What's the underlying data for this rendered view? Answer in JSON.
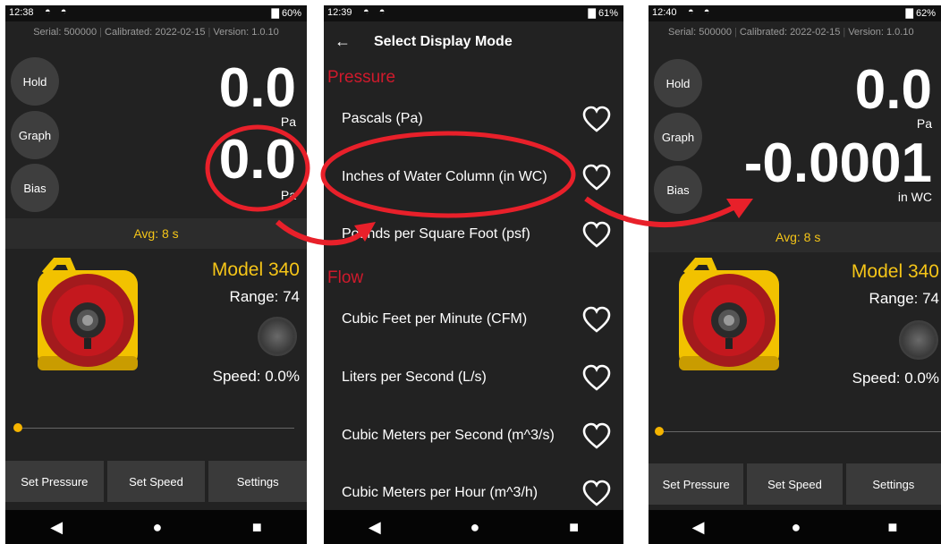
{
  "screen1": {
    "status": {
      "time": "12:38",
      "icons": "◓ ◓",
      "battery": "▇ 60%"
    },
    "info": {
      "serial": "Serial: 500000",
      "calibrated": "Calibrated: 2022-02-15",
      "version": "Version: 1.0.10"
    },
    "buttons": {
      "hold": "Hold",
      "graph": "Graph",
      "bias": "Bias"
    },
    "reading1": {
      "value": "0.0",
      "unit": "Pa"
    },
    "reading2": {
      "value": "0.0",
      "unit": "Pa"
    },
    "avg": "Avg: 8 s",
    "model": "Model 340",
    "range": "Range: 74",
    "speed": "Speed: 0.0%",
    "slider_level": 0.0,
    "bottom": {
      "set_pressure": "Set Pressure",
      "set_speed": "Set Speed",
      "settings": "Settings"
    }
  },
  "screen2": {
    "status": {
      "time": "12:39",
      "icons": "◓ ◓",
      "battery": "▇ 61%"
    },
    "back": "←",
    "title": "Select Display Mode",
    "section_pressure": "Pressure",
    "pressure_items": [
      "Pascals (Pa)",
      "Inches of Water Column (in WC)",
      "Pounds per Square Foot (psf)"
    ],
    "section_flow": "Flow",
    "flow_items": [
      "Cubic Feet per Minute (CFM)",
      "Liters per Second (L/s)",
      "Cubic Meters per Second (m^3/s)",
      "Cubic Meters per Hour (m^3/h)"
    ]
  },
  "screen3": {
    "status": {
      "time": "12:40",
      "icons": "◓ ◓",
      "battery": "▇ 62%"
    },
    "info": {
      "serial": "Serial: 500000",
      "calibrated": "Calibrated: 2022-02-15",
      "version": "Version: 1.0.10"
    },
    "buttons": {
      "hold": "Hold",
      "graph": "Graph",
      "bias": "Bias"
    },
    "reading1": {
      "value": "0.0",
      "unit": "Pa"
    },
    "reading2": {
      "value": "-0.0001",
      "unit": "in WC"
    },
    "avg": "Avg: 8 s",
    "model": "Model 340",
    "range": "Range: 74",
    "speed": "Speed: 0.0%",
    "slider_level": 0.0,
    "bottom": {
      "set_pressure": "Set Pressure",
      "set_speed": "Set Speed",
      "settings": "Settings"
    }
  },
  "nav": {
    "back": "◀",
    "home": "●",
    "recents": "■"
  },
  "colors": {
    "accent_yellow": "#f5c518",
    "section_red": "#d01a2c",
    "annotation_red": "#e8202a",
    "background": "#222222"
  }
}
